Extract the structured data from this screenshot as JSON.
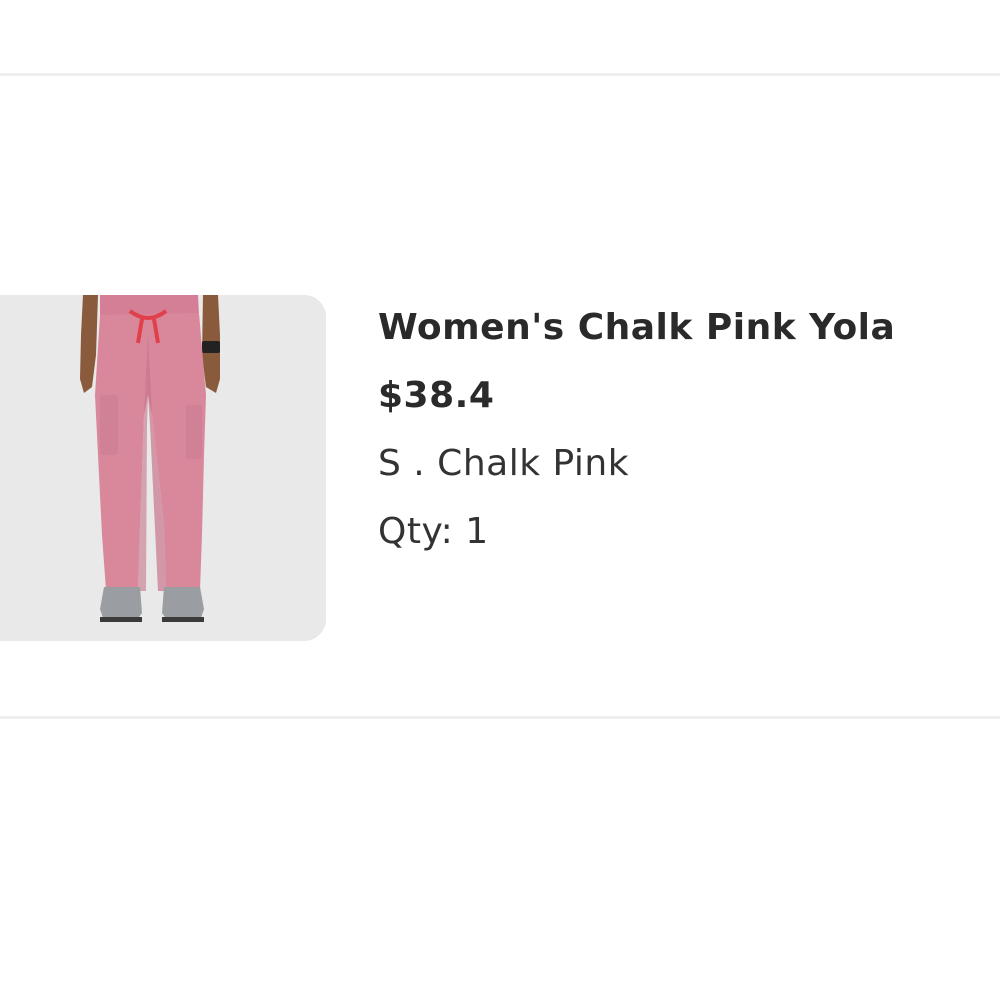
{
  "cart_item": {
    "title": "Women's Chalk Pink Yola",
    "price": "$38.4",
    "variant": "S . Chalk Pink",
    "qty_label": "Qty: 1",
    "image_description": "Product photo of pink scrub pants",
    "colors": {
      "pants": "#d9879b",
      "pants_shadow": "#c7758a",
      "drawstring": "#e0404a",
      "skin": "#8a5a3c",
      "shoes": "#9a9ea3",
      "background": "#e9e9e9"
    }
  }
}
